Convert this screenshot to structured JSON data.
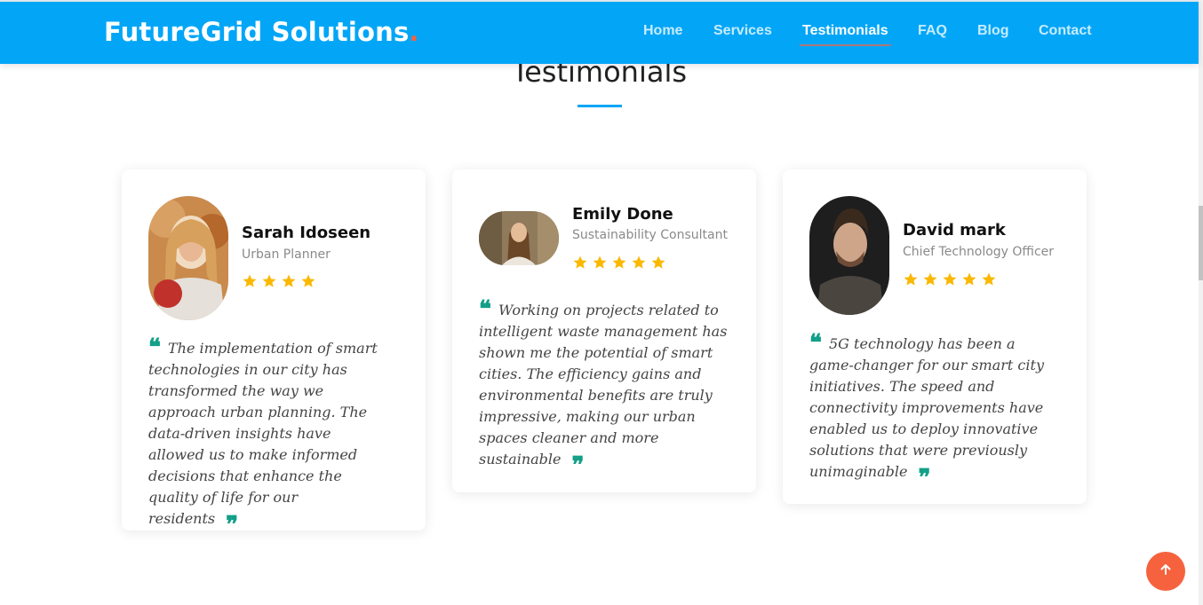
{
  "header": {
    "brand": "FutureGrid Solutions",
    "brand_dot": ".",
    "nav": [
      "Home",
      "Services",
      "Testimonials",
      "FAQ",
      "Blog",
      "Contact"
    ],
    "active_nav": "Testimonials"
  },
  "section": {
    "title": "Testimonials"
  },
  "testimonials": [
    {
      "name": "Sarah Idoseen",
      "role": "Urban Planner",
      "rating": 4,
      "quote": "The implementation of smart technologies in our city has transformed the way we approach urban planning. The data-driven insights have allowed us to make informed decisions that enhance the quality of life for our residents"
    },
    {
      "name": "Emily Done",
      "role": "Sustainability Consultant",
      "rating": 5,
      "quote": "Working on projects related to intelligent waste management has shown me the potential of smart cities. The efficiency gains and environmental benefits are truly impressive, making our urban spaces cleaner and more sustainable"
    },
    {
      "name": "David mark",
      "role": "Chief Technology Officer",
      "rating": 5,
      "quote": "5G technology has been a game-changer for our smart city initiatives. The speed and connectivity improvements have enabled us to deploy innovative solutions that were previously unimaginable"
    }
  ],
  "colors": {
    "header_bg": "#03a6f7",
    "accent": "#f6623e",
    "star": "#fbb800",
    "quote_mark": "#129f88"
  },
  "icons": {
    "star": "star-icon",
    "open_quote": "quote-open-icon",
    "close_quote": "quote-close-icon",
    "scroll_top": "arrow-up-icon"
  },
  "quote_marks": {
    "open": "❝",
    "close": "❞"
  }
}
